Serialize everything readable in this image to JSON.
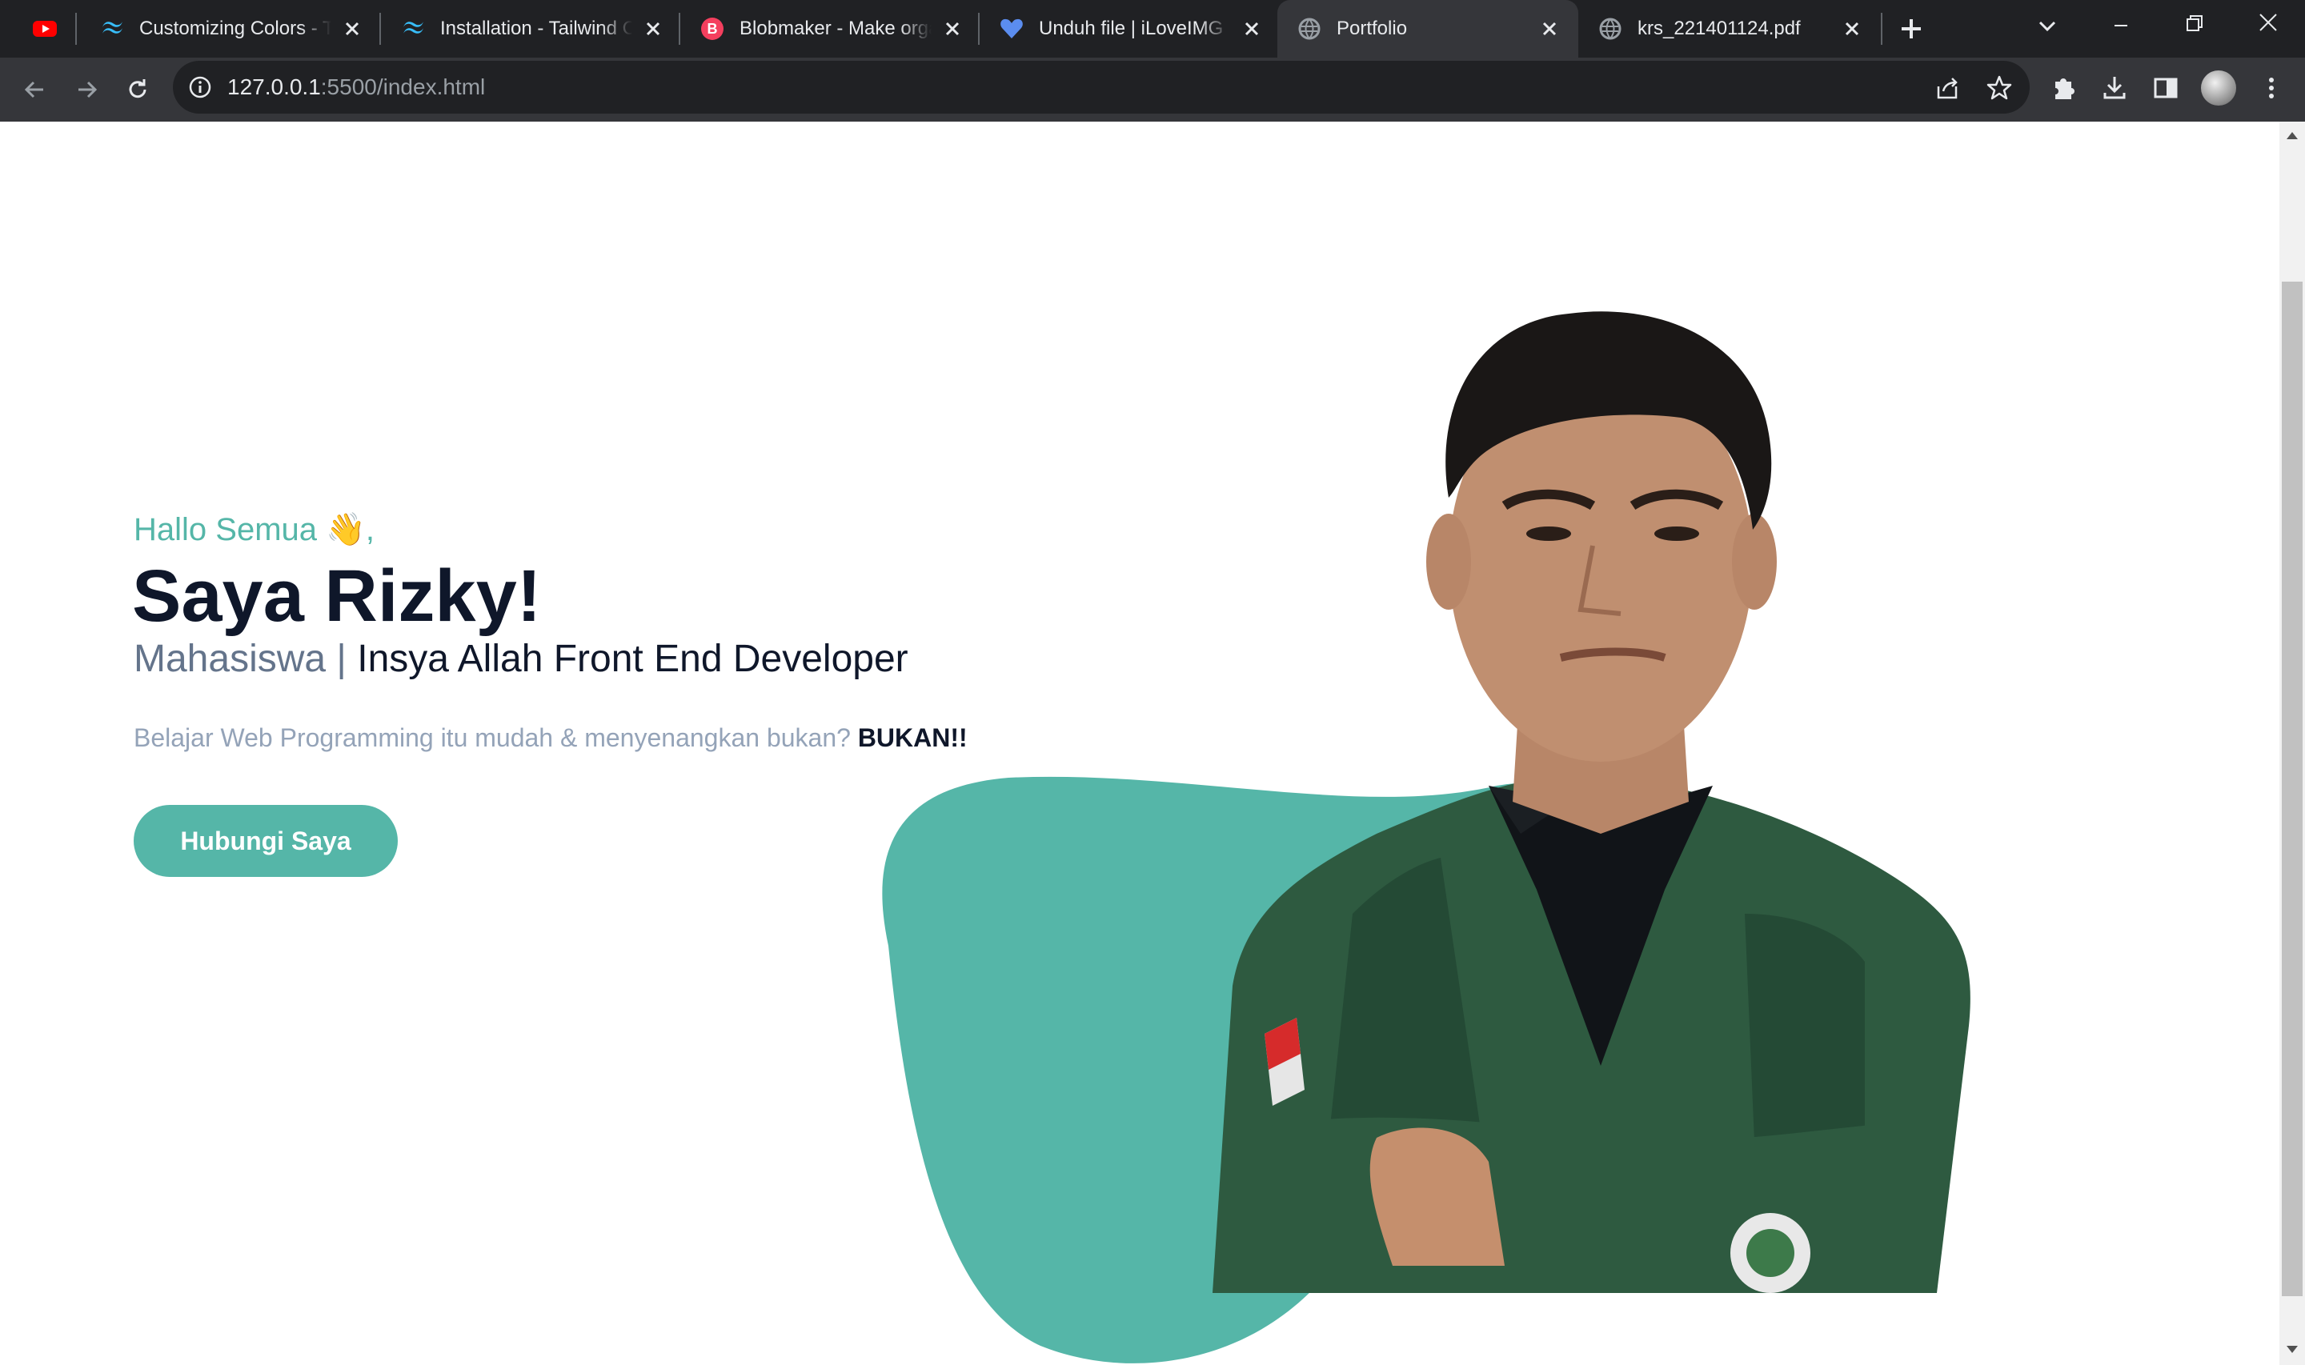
{
  "browser": {
    "tabs": [
      {
        "title": "",
        "icon": "youtube-icon"
      },
      {
        "title": "Customizing Colors - Tailwind CSS",
        "icon": "tailwind-icon"
      },
      {
        "title": "Installation - Tailwind CSS",
        "icon": "tailwind-icon"
      },
      {
        "title": "Blobmaker - Make organic SVG shapes",
        "icon": "blobmaker-icon"
      },
      {
        "title": "Unduh file | iLoveIMG",
        "icon": "iloveimg-heart-icon"
      },
      {
        "title": "Portfolio",
        "icon": "globe-icon",
        "active": true
      },
      {
        "title": "krs_221401124.pdf",
        "icon": "globe-icon"
      }
    ],
    "url_host": "127.0.0.1",
    "url_rest": ":5500/index.html"
  },
  "hero": {
    "greeting": "Hallo Semua 👋,",
    "name": "Saya Rizky!",
    "role_muted": "Mahasiswa |",
    "role_main": "Insya Allah Front End Developer",
    "tagline": "Belajar Web Programming itu mudah & menyenangkan bukan?",
    "tagline_bold": "BUKAN!!",
    "cta_label": "Hubungi Saya"
  },
  "colors": {
    "primary": "#55b6a8",
    "dark": "#0f172a",
    "chrome_bg": "#202124",
    "chrome_toolbar": "#35363a"
  }
}
